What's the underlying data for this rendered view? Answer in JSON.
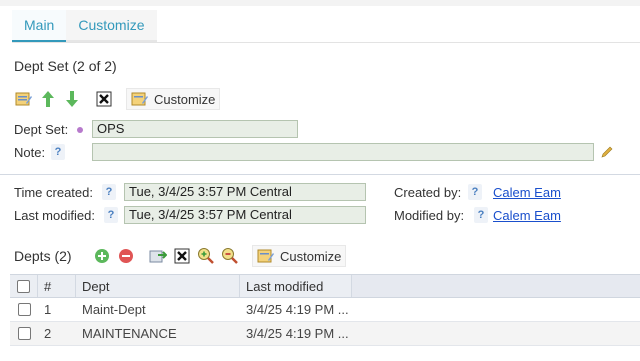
{
  "tabs": [
    {
      "label": "Main"
    },
    {
      "label": "Customize"
    }
  ],
  "dept_set": {
    "title": "Dept Set (2 of 2)",
    "customize_label": "Customize",
    "field_label": "Dept Set:",
    "field_value": "OPS",
    "note_label": "Note:",
    "note_value": "",
    "help_glyph": "?"
  },
  "audit": {
    "created_label": "Time created:",
    "created_value": "Tue, 3/4/25 3:57 PM Central",
    "modified_label": "Last modified:",
    "modified_value": "Tue, 3/4/25 3:57 PM Central",
    "created_by_label": "Created by:",
    "created_by_value": "Calem Eam",
    "modified_by_label": "Modified by:",
    "modified_by_value": "Calem Eam"
  },
  "depts": {
    "title": "Depts (2)",
    "customize_label": "Customize",
    "columns": [
      "#",
      "Dept",
      "Last modified"
    ],
    "rows": [
      {
        "num": "1",
        "dept": "Maint-Dept",
        "modified": "3/4/25 4:19 PM ..."
      },
      {
        "num": "2",
        "dept": "MAINTENANCE",
        "modified": "3/4/25 4:19 PM ..."
      }
    ]
  },
  "colors": {
    "accent": "#3399bb",
    "link": "#1a4fcc",
    "field_bg": "#e8eee6",
    "add_green": "#5cb85c",
    "remove_red": "#e05555"
  }
}
